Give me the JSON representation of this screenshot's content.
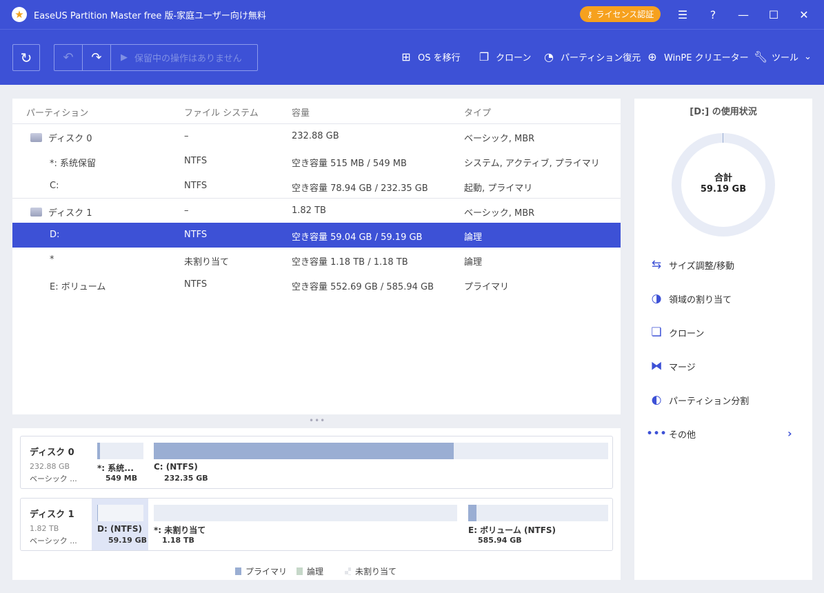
{
  "window": {
    "title": "EaseUS Partition Master free 版-家庭ユーザー向け無料",
    "license_label": "ライセンス認証"
  },
  "toolbar": {
    "pending_label": "保留中の操作はありません",
    "items": [
      {
        "label": "OS を移行",
        "icon": "windows-icon"
      },
      {
        "label": "クローン",
        "icon": "clone-icon"
      },
      {
        "label": "パーティション復元",
        "icon": "pie-icon"
      },
      {
        "label": "WinPE クリエーター",
        "icon": "plus-circle-icon"
      },
      {
        "label": "ツール",
        "icon": "wrench-icon"
      }
    ]
  },
  "partition_table": {
    "headers": [
      "パーティション",
      "ファイル システム",
      "容量",
      "タイプ"
    ],
    "rows": [
      {
        "name": "ディスク 0",
        "fs": "–",
        "capacity": "232.88 GB",
        "type": "ベーシック, MBR",
        "is_disk": true,
        "selected": false
      },
      {
        "name": "*: 系统保留",
        "fs": "NTFS",
        "capacity": "空き容量 515 MB / 549 MB",
        "type": "システム, アクティブ, プライマリ",
        "is_disk": false,
        "selected": false
      },
      {
        "name": "C:",
        "fs": "NTFS",
        "capacity": "空き容量 78.94 GB / 232.35 GB",
        "type": "起動, プライマリ",
        "is_disk": false,
        "selected": false
      },
      {
        "name": "ディスク 1",
        "fs": "–",
        "capacity": "1.82 TB",
        "type": "ベーシック, MBR",
        "is_disk": true,
        "selected": false
      },
      {
        "name": "D:",
        "fs": "NTFS",
        "capacity": "空き容量 59.04 GB / 59.19 GB",
        "type": "論理",
        "is_disk": false,
        "selected": true
      },
      {
        "name": "*",
        "fs": "未割り当て",
        "capacity": "空き容量 1.18 TB / 1.18 TB",
        "type": "論理",
        "is_disk": false,
        "selected": false
      },
      {
        "name": "E: ボリューム",
        "fs": "NTFS",
        "capacity": "空き容量 552.69 GB / 585.94 GB",
        "type": "プライマリ",
        "is_disk": false,
        "selected": false
      }
    ]
  },
  "disk_map": {
    "disks": [
      {
        "name": "ディスク 0",
        "size": "232.88 GB",
        "type": "ベーシック ...",
        "segments": [
          {
            "label": "*: 系统...",
            "size": "549 MB",
            "used_fraction": 0.06
          },
          {
            "label": "C: (NTFS)",
            "size": "232.35 GB",
            "used_fraction": 0.66
          }
        ]
      },
      {
        "name": "ディスク 1",
        "size": "1.82 TB",
        "type": "ベーシック ...",
        "segments": [
          {
            "label": "D: (NTFS)",
            "size": "59.19 GB",
            "used_fraction": 0.0
          },
          {
            "label": "*: 未割り当て",
            "size": "1.18 TB",
            "used_fraction": 0.0
          },
          {
            "label": "E: ボリューム (NTFS)",
            "size": "585.94 GB",
            "used_fraction": 0.06
          }
        ]
      }
    ],
    "legend": [
      {
        "label": "プライマリ",
        "color": "#9aaed3"
      },
      {
        "label": "論理",
        "color": "#c6d8c9"
      },
      {
        "label": "未割り当て",
        "color": "#e4e6ea"
      }
    ]
  },
  "usage_panel": {
    "title": "[D:] の使用状況",
    "total_label": "合計",
    "total_value": "59.19 GB",
    "actions": [
      {
        "label": "サイズ調整/移動",
        "icon": "resize-icon"
      },
      {
        "label": "領域の割り当て",
        "icon": "pie-icon"
      },
      {
        "label": "クローン",
        "icon": "clone-icon"
      },
      {
        "label": "マージ",
        "icon": "merge-icon"
      },
      {
        "label": "パーティション分割",
        "icon": "split-icon"
      },
      {
        "label": "その他",
        "icon": "more-icon"
      }
    ]
  },
  "colors": {
    "accent": "#3d51d6",
    "license": "#f6a11e",
    "primary_bar": "#9aaed3"
  }
}
